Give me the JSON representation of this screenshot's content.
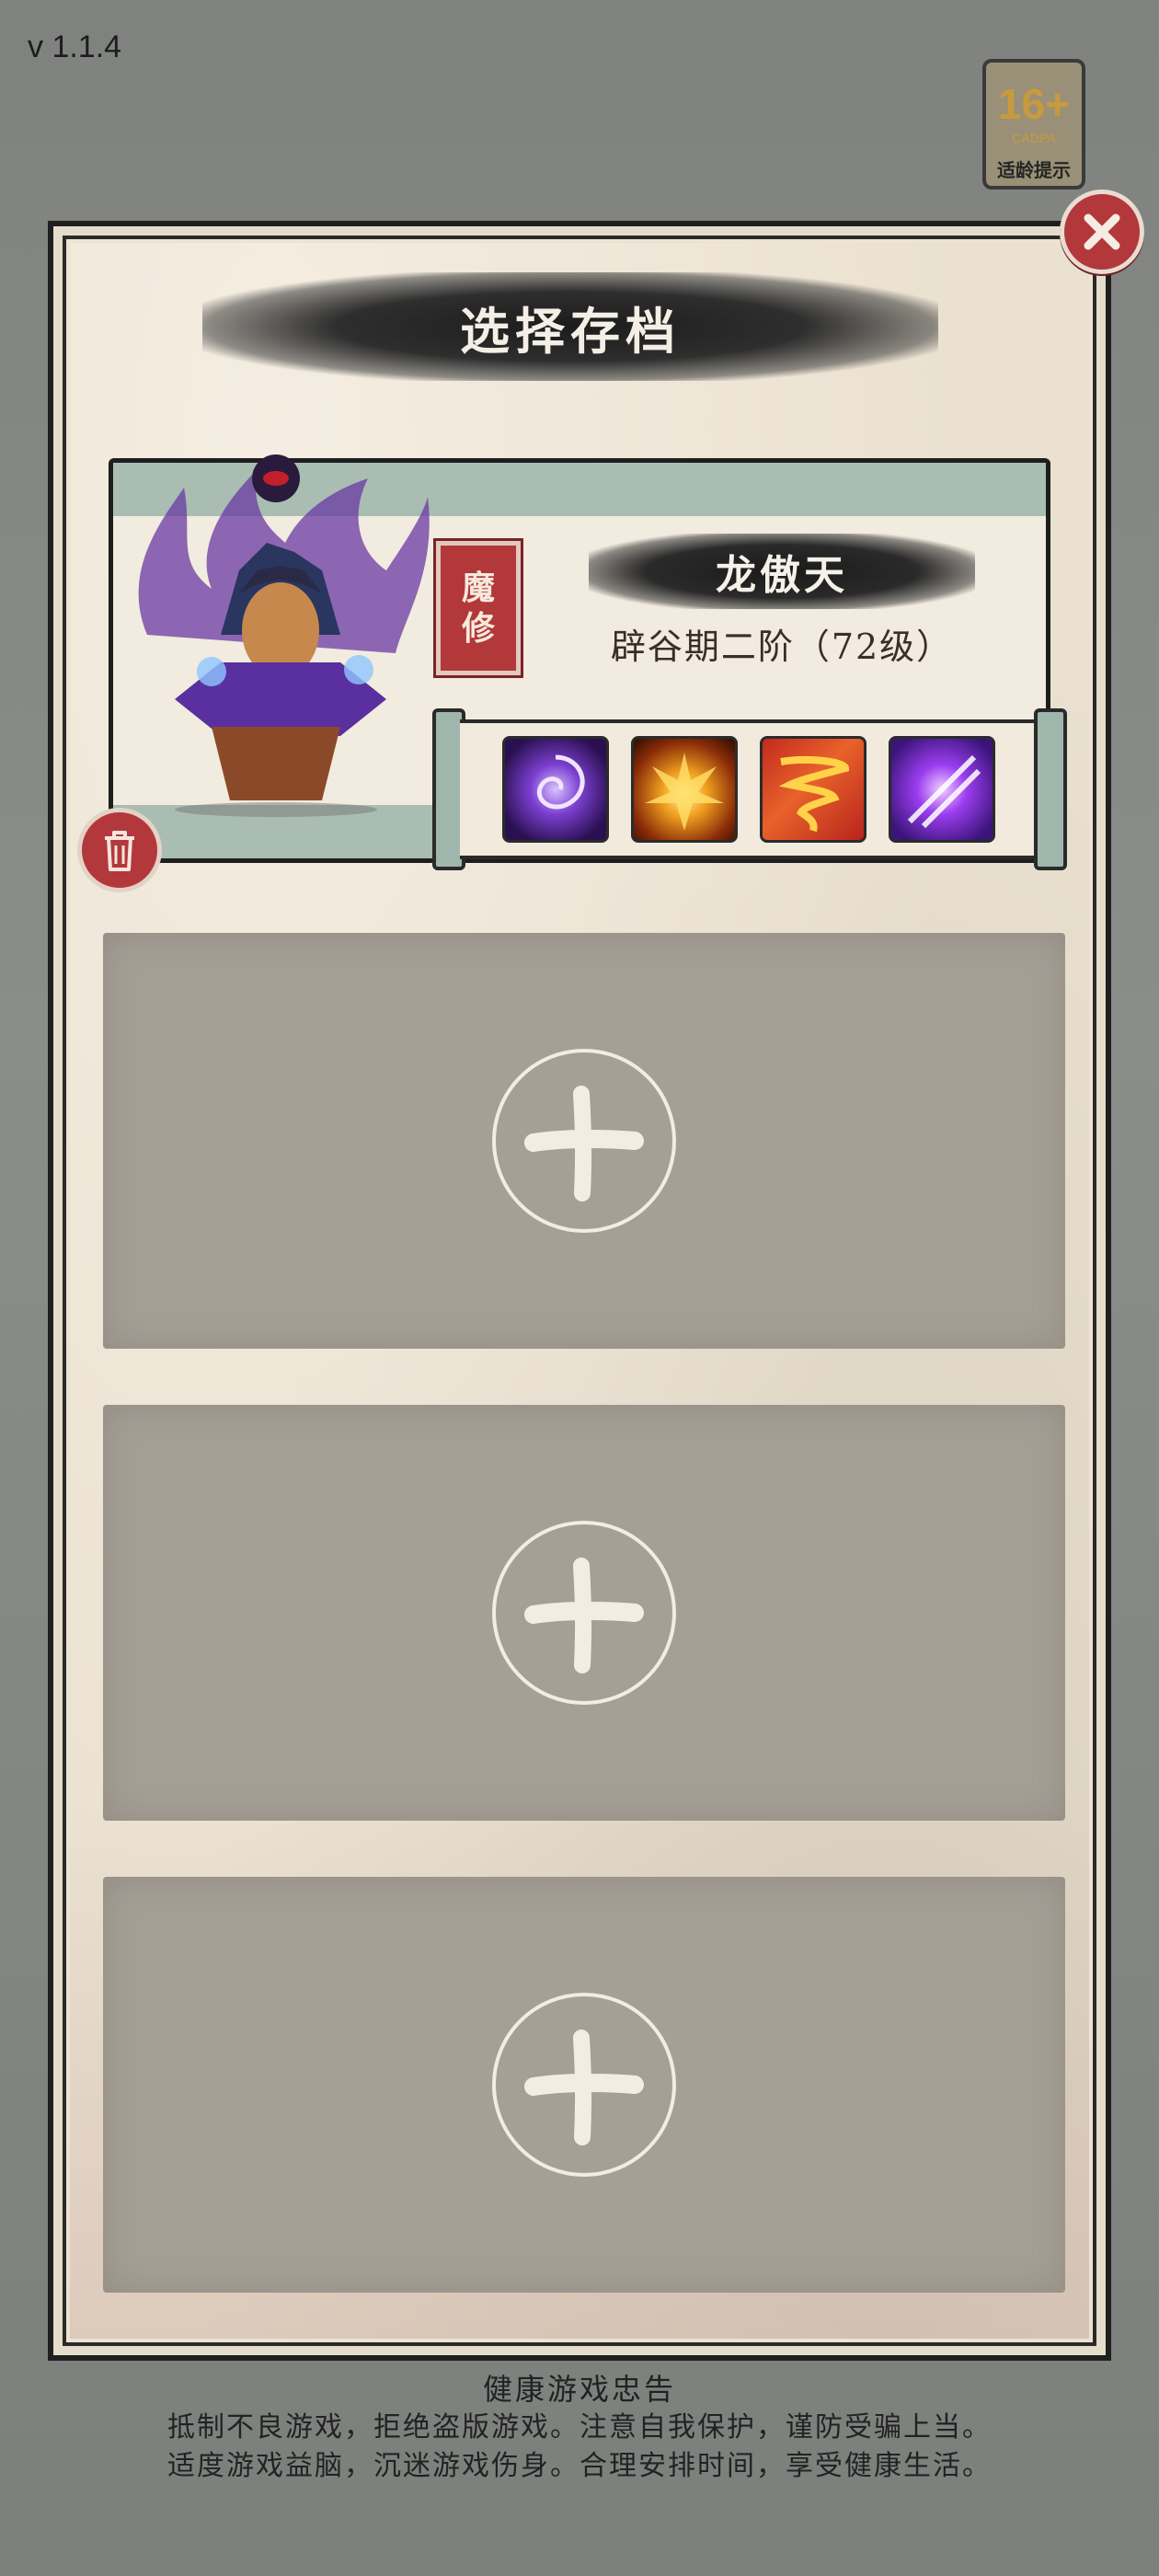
{
  "version": "v 1.1.4",
  "age_rating": {
    "number": "16+",
    "org": "CADPA",
    "label": "适龄提示"
  },
  "dialog": {
    "title": "选择存档",
    "close_icon": "close-icon"
  },
  "save_slot": {
    "class_label_line1": "魔",
    "class_label_line2": "修",
    "character_name": "龙傲天",
    "realm": "辟谷期二阶（72级）",
    "skills": [
      "purple-vortex-skill-icon",
      "flame-burst-skill-icon",
      "fire-tornado-skill-icon",
      "arcane-slash-skill-icon"
    ],
    "delete_icon": "trash-icon"
  },
  "empty_slots": [
    {
      "icon": "plus-icon"
    },
    {
      "icon": "plus-icon"
    },
    {
      "icon": "plus-icon"
    }
  ],
  "health_notice": {
    "title": "健康游戏忠告",
    "line1": "抵制不良游戏，拒绝盗版游戏。注意自我保护，谨防受骗上当。",
    "line2": "适度游戏益脑，沉迷游戏伤身。合理安排时间，享受健康生活。"
  },
  "colors": {
    "accent_red": "#b3383c",
    "slot_gray": "#a59f96",
    "jade": "#a9bdb3",
    "paper": "#eae1d0"
  }
}
